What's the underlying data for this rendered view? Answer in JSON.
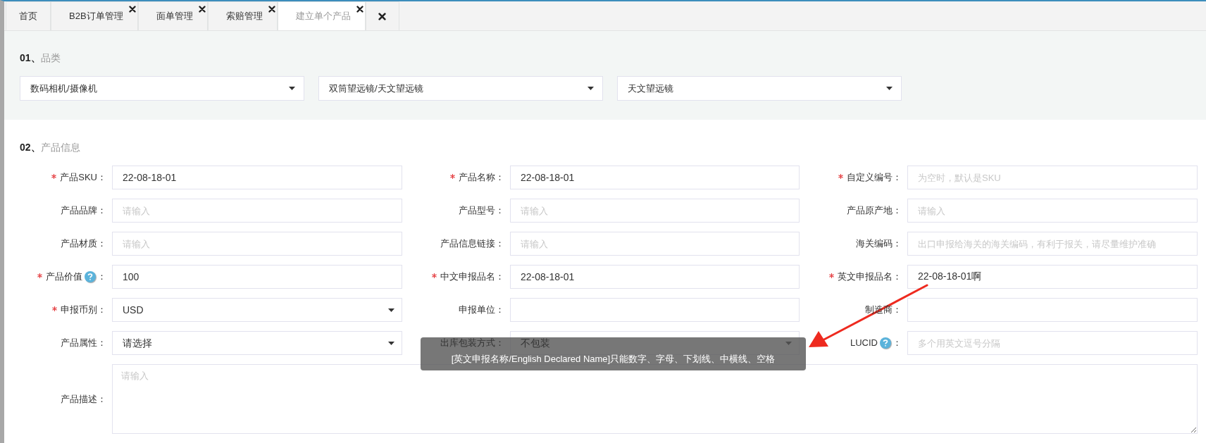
{
  "tabs": [
    {
      "kind": "home",
      "label": "首页",
      "selected": false
    },
    {
      "kind": "closable",
      "label": "B2B订单管理",
      "selected": false
    },
    {
      "kind": "closable",
      "label": "面单管理",
      "selected": false
    },
    {
      "kind": "closable",
      "label": "索赔管理",
      "selected": false
    },
    {
      "kind": "closable",
      "label": "建立单个产品",
      "selected": true
    },
    {
      "kind": "close-all",
      "selected": false
    }
  ],
  "category_section": {
    "number": "01、",
    "title": "品类",
    "selects": [
      {
        "value": "数码相机/摄像机"
      },
      {
        "value": "双筒望远镜/天文望远镜"
      },
      {
        "value": "天文望远镜"
      }
    ]
  },
  "info_section": {
    "number": "02、",
    "title": "产品信息",
    "fields": [
      {
        "label": "产品SKU：",
        "required": true,
        "help": false,
        "kind": "input",
        "value": "22-08-18-01"
      },
      {
        "label": "产品名称：",
        "required": true,
        "help": false,
        "kind": "input",
        "value": "22-08-18-01"
      },
      {
        "label": "自定义编号：",
        "required": true,
        "help": false,
        "kind": "input",
        "placeholder": "为空时，默认是SKU"
      },
      {
        "label": "产品品牌：",
        "required": false,
        "help": false,
        "kind": "input",
        "placeholder": "请输入"
      },
      {
        "label": "产品型号：",
        "required": false,
        "help": false,
        "kind": "input",
        "placeholder": "请输入"
      },
      {
        "label": "产品原产地：",
        "required": false,
        "help": false,
        "kind": "input",
        "placeholder": "请输入"
      },
      {
        "label": "产品材质：",
        "required": false,
        "help": false,
        "kind": "input",
        "placeholder": "请输入"
      },
      {
        "label": "产品信息链接：",
        "required": false,
        "help": false,
        "kind": "input",
        "placeholder": "请输入"
      },
      {
        "label": "海关编码：",
        "required": false,
        "help": false,
        "kind": "input",
        "placeholder": "出口申报给海关的海关编码，有利于报关，请尽量维护准确"
      },
      {
        "label": "产品价值",
        "suffix": "：",
        "required": true,
        "help": true,
        "kind": "input",
        "value": "100"
      },
      {
        "label": "中文申报品名：",
        "required": true,
        "help": false,
        "kind": "input",
        "value": "22-08-18-01"
      },
      {
        "label": "英文申报品名：",
        "required": true,
        "help": false,
        "kind": "input",
        "value": "22-08-18-01啊"
      },
      {
        "label": "申报币别：",
        "required": true,
        "help": false,
        "kind": "select",
        "value": "USD"
      },
      {
        "label": "申报单位：",
        "required": false,
        "help": false,
        "kind": "input"
      },
      {
        "label": "制造商：",
        "required": false,
        "help": false,
        "kind": "input"
      },
      {
        "label": "产品属性：",
        "required": false,
        "help": false,
        "kind": "select",
        "value": "请选择"
      },
      {
        "label": "出库包装方式：",
        "required": false,
        "help": false,
        "kind": "select",
        "value": "不包装"
      },
      {
        "label": "LUCID",
        "suffix": "：",
        "required": false,
        "help": true,
        "kind": "input",
        "placeholder": "多个用英文逗号分隔"
      },
      {
        "label": "产品描述：",
        "required": false,
        "help": false,
        "kind": "textarea",
        "placeholder": "请输入"
      }
    ]
  },
  "tooltip": {
    "text": "[英文申报名称/English Declared Name]只能数字、字母、下划线、中横线、空格"
  }
}
